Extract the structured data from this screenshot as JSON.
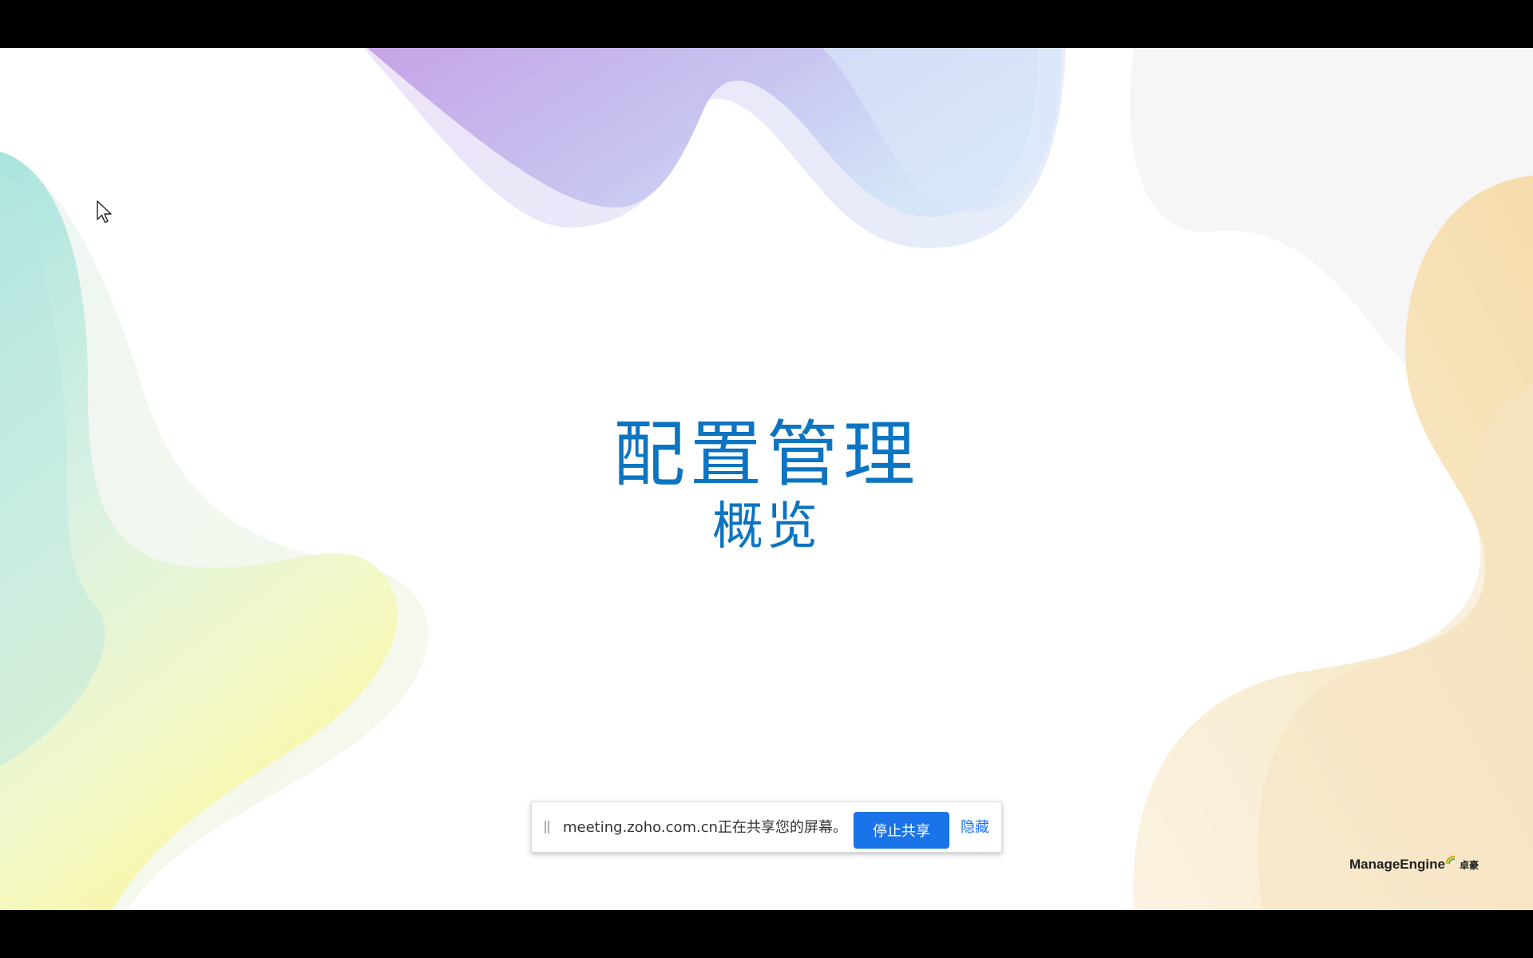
{
  "slide": {
    "title": "配置管理",
    "subtitle": "概览"
  },
  "share_bar": {
    "message": "meeting.zoho.com.cn正在共享您的屏幕。",
    "stop_label": "停止共享",
    "hide_label": "隐藏"
  },
  "brand": {
    "name": "ManageEngine",
    "name_cn": "卓豪"
  },
  "colors": {
    "title": "#0c74c1",
    "stop_button": "#1a73e8",
    "hide_link": "#1a73e8"
  },
  "icons": {
    "cursor": "mouse-pointer-icon",
    "drag": "drag-handle-icon",
    "brand_mark": "manageengine-arc-icon"
  }
}
